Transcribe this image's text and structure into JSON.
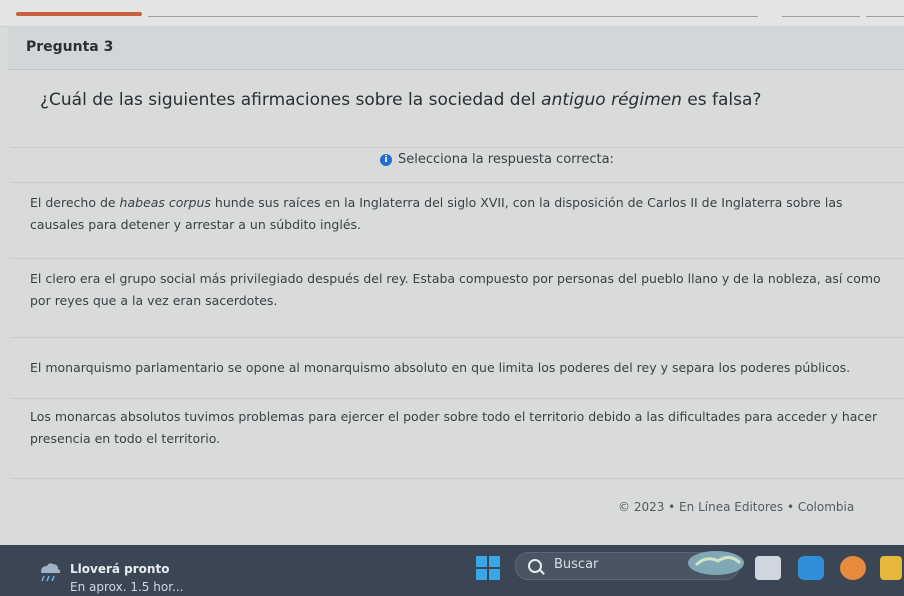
{
  "header": {
    "title": "Pregunta 3"
  },
  "question": {
    "before": "¿Cuál de las siguientes afirmaciones sobre la sociedad del ",
    "emphasis": "antiguo régimen",
    "after": " es falsa?"
  },
  "instruction": {
    "icon": "info-icon",
    "text": "Selecciona la respuesta correcta:"
  },
  "options": [
    {
      "before": "El derecho de ",
      "emphasis": "habeas corpus",
      "after": " hunde sus raíces en la Inglaterra del siglo XVII, con la disposición de Carlos II de Inglaterra sobre las causales para detener y arrestar a un súbdito inglés."
    },
    {
      "text": "El clero era el grupo social más privilegiado después del rey. Estaba compuesto por personas del pueblo llano y de la nobleza, así como por reyes que a la vez eran sacerdotes."
    },
    {
      "text": "El monarquismo parlamentario se opone al monarquismo absoluto en que limita los poderes del rey y separa los poderes públicos."
    },
    {
      "text": "Los monarcas absolutos tuvimos problemas para ejercer el poder sobre todo el territorio debido a las dificultades para acceder y hacer presencia en todo el territorio."
    }
  ],
  "footer": {
    "copyright": "© 2023 • En Línea Editores • Colombia"
  },
  "taskbar": {
    "weather": {
      "icon": "rain-cloud-icon",
      "title": "Lloverá pronto",
      "subtitle": "En aprox. 1.5 hor..."
    },
    "start_icon": "windows-start-icon",
    "search": {
      "label": "Buscar",
      "icon": "search-icon"
    }
  },
  "colors": {
    "accent": "#c8613a",
    "info": "#1f6fd1",
    "taskbar": "#3b4654"
  }
}
